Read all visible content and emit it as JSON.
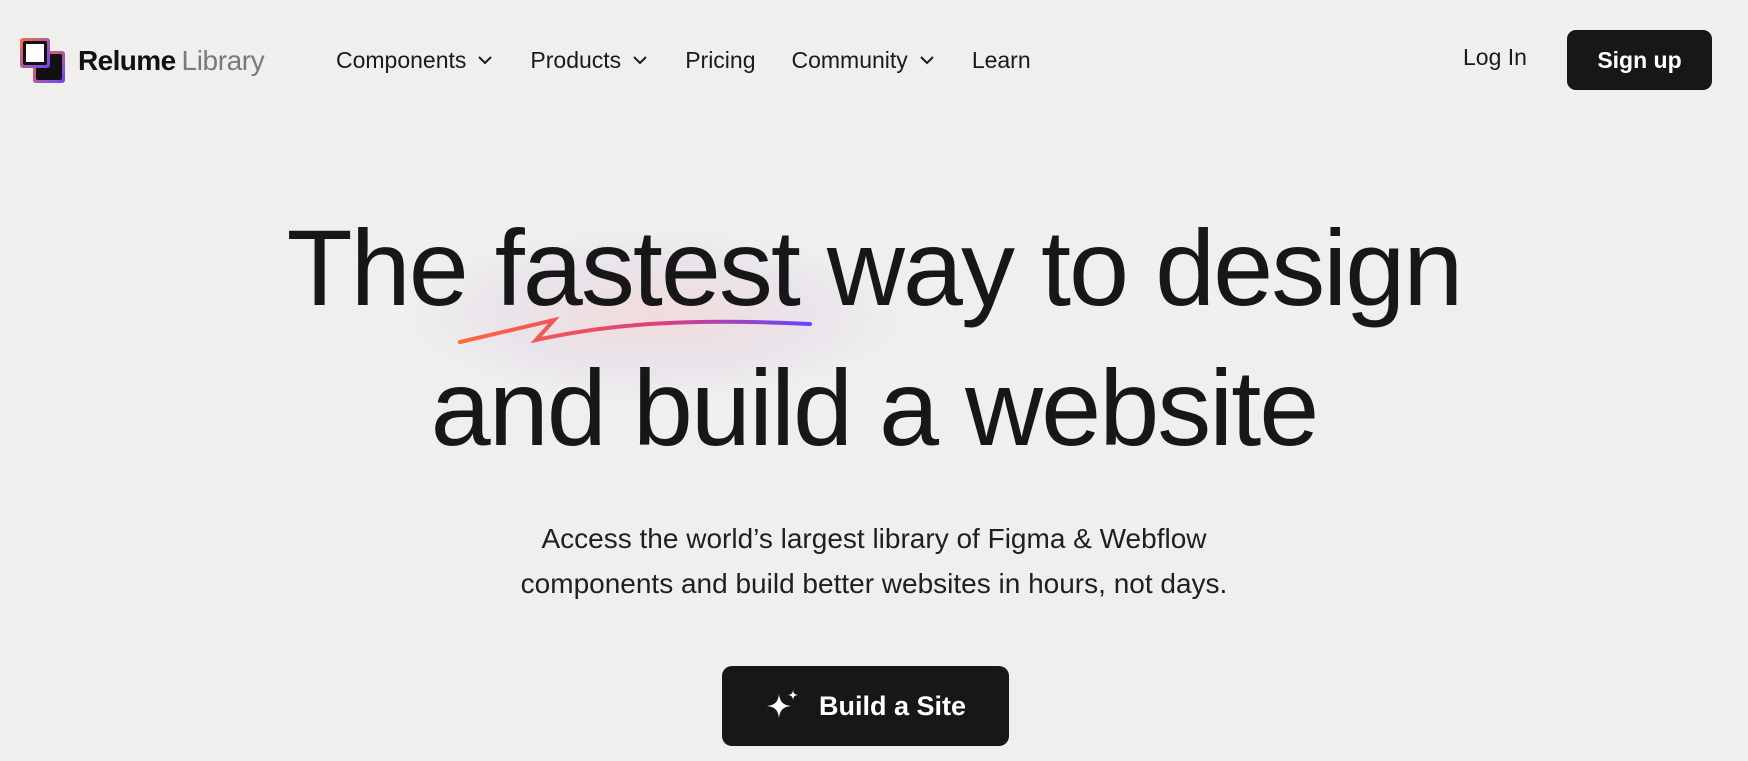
{
  "nav": {
    "logo": {
      "primary": "Relume",
      "secondary": "Library"
    },
    "items": [
      {
        "label": "Components",
        "dropdown": true
      },
      {
        "label": "Products",
        "dropdown": true
      },
      {
        "label": "Pricing",
        "dropdown": false
      },
      {
        "label": "Community",
        "dropdown": true
      },
      {
        "label": "Learn",
        "dropdown": false
      }
    ],
    "login_label": "Log In",
    "signup_label": "Sign up"
  },
  "hero": {
    "headline_line1": "The fastest way to design",
    "headline_line2": "and build a website",
    "subtext_line1": "Access the world’s largest library of Figma & Webflow",
    "subtext_line2": "components and build better websites in hours, not days.",
    "cta_label": "Build a Site",
    "cta_icon": "sparkle-icon"
  },
  "colors": {
    "background": "#f0efed",
    "text": "#171717",
    "button": "#171717",
    "accent_orange": "#ff6a3d",
    "accent_purple": "#6248ff"
  }
}
